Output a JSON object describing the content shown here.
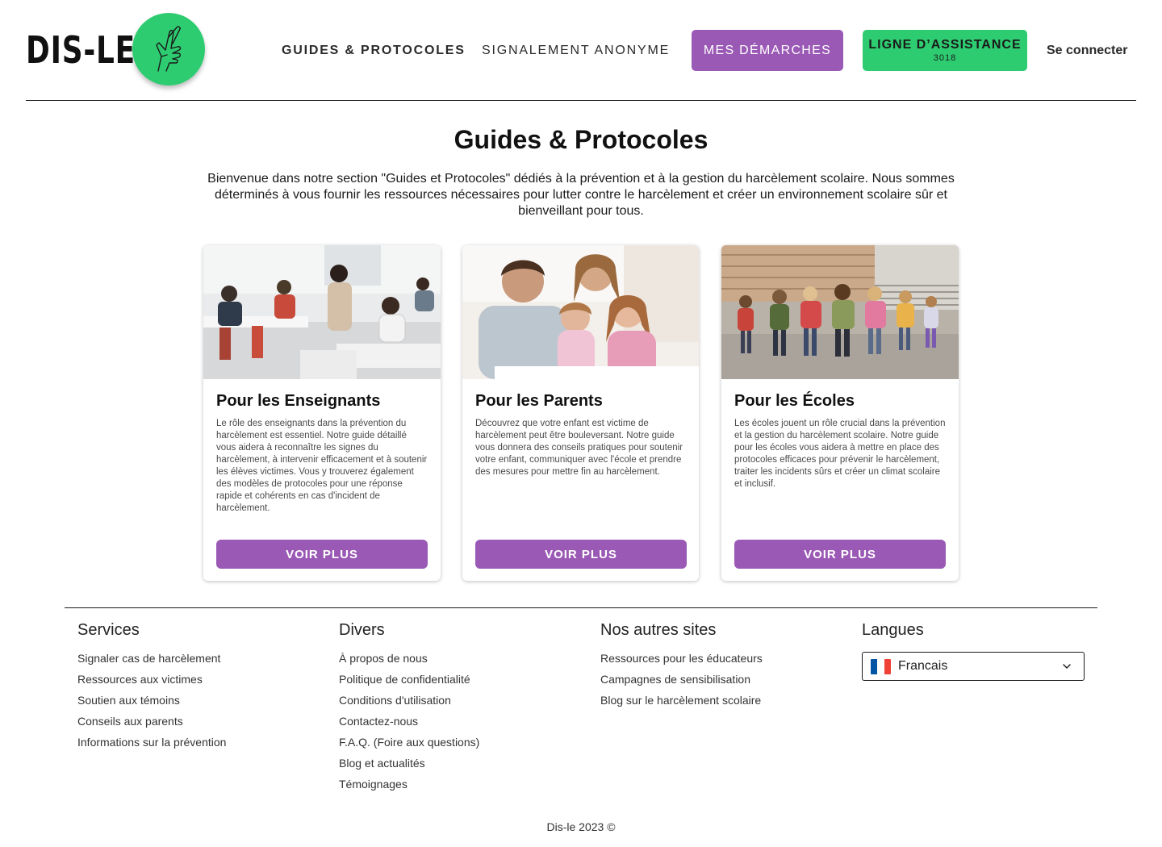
{
  "header": {
    "logo_text": "DIS-LE",
    "nav": {
      "guides": "GUIDES & PROTOCOLES",
      "signalement": "SIGNALEMENT ANONYME",
      "demarches": "MES DÉMARCHES",
      "assistance_title": "LIGNE D’ASSISTANCE",
      "assistance_number": "3018",
      "login": "Se connecter"
    }
  },
  "main": {
    "title": "Guides & Protocoles",
    "intro": "Bienvenue dans notre section \"Guides et Protocoles\" dédiés à la prévention et à la gestion du harcèlement scolaire. Nous sommes déterminés à vous fournir les ressources nécessaires pour lutter contre le harcèlement et créer un environnement scolaire sûr et bienveillant pour tous.",
    "cards": [
      {
        "title": "Pour les Enseignants",
        "text": "Le rôle des enseignants dans la prévention du harcèlement est essentiel. Notre guide détaillé vous aidera à reconnaître les signes du harcèlement, à intervenir efficacement et à soutenir les élèves victimes. Vous y trouverez également des modèles de protocoles pour une réponse rapide et cohérents en cas d'incident de harcèlement.",
        "button": "VOIR PLUS"
      },
      {
        "title": "Pour les Parents",
        "text": "Découvrez que votre enfant est victime de harcèlement peut être bouleversant. Notre guide vous donnera des conseils pratiques pour soutenir votre enfant, communiquer avec l'école et prendre des mesures pour mettre fin au harcèlement.",
        "button": "VOIR PLUS"
      },
      {
        "title": "Pour les Écoles",
        "text": "Les écoles jouent un rôle crucial dans la prévention et la gestion du harcèlement scolaire. Notre guide pour les écoles vous aidera à mettre en place des protocoles efficaces pour prévenir le harcèlement, traiter les incidents sûrs et créer un climat scolaire et inclusif.",
        "button": "VOIR PLUS"
      }
    ]
  },
  "footer": {
    "services": {
      "title": "Services",
      "links": [
        "Signaler cas de harcèlement",
        "Ressources aux victimes",
        "Soutien aux témoins",
        "Conseils aux parents",
        "Informations sur la prévention"
      ]
    },
    "divers": {
      "title": "Divers",
      "links": [
        "À propos de nous",
        "Politique de confidentialité",
        "Conditions d'utilisation",
        "Contactez-nous",
        "F.A.Q. (Foire aux questions)",
        "Blog et actualités",
        "Témoignages"
      ]
    },
    "autres": {
      "title": "Nos autres sites",
      "links": [
        "Ressources pour les éducateurs",
        "Campagnes de sensibilisation",
        "Blog sur le harcèlement scolaire"
      ]
    },
    "langues": {
      "title": "Langues",
      "selected": "Francais"
    },
    "copyright": "Dis-le 2023 ©"
  },
  "colors": {
    "purple": "#9b59b6",
    "green": "#2ecc71",
    "flag_blue": "#0055a4",
    "flag_white": "#ffffff",
    "flag_red": "#ef4135"
  },
  "icons": {
    "logo_mark": "crossed-fingers-icon",
    "select": "chevron-down-icon",
    "flag": "france-flag-icon"
  }
}
